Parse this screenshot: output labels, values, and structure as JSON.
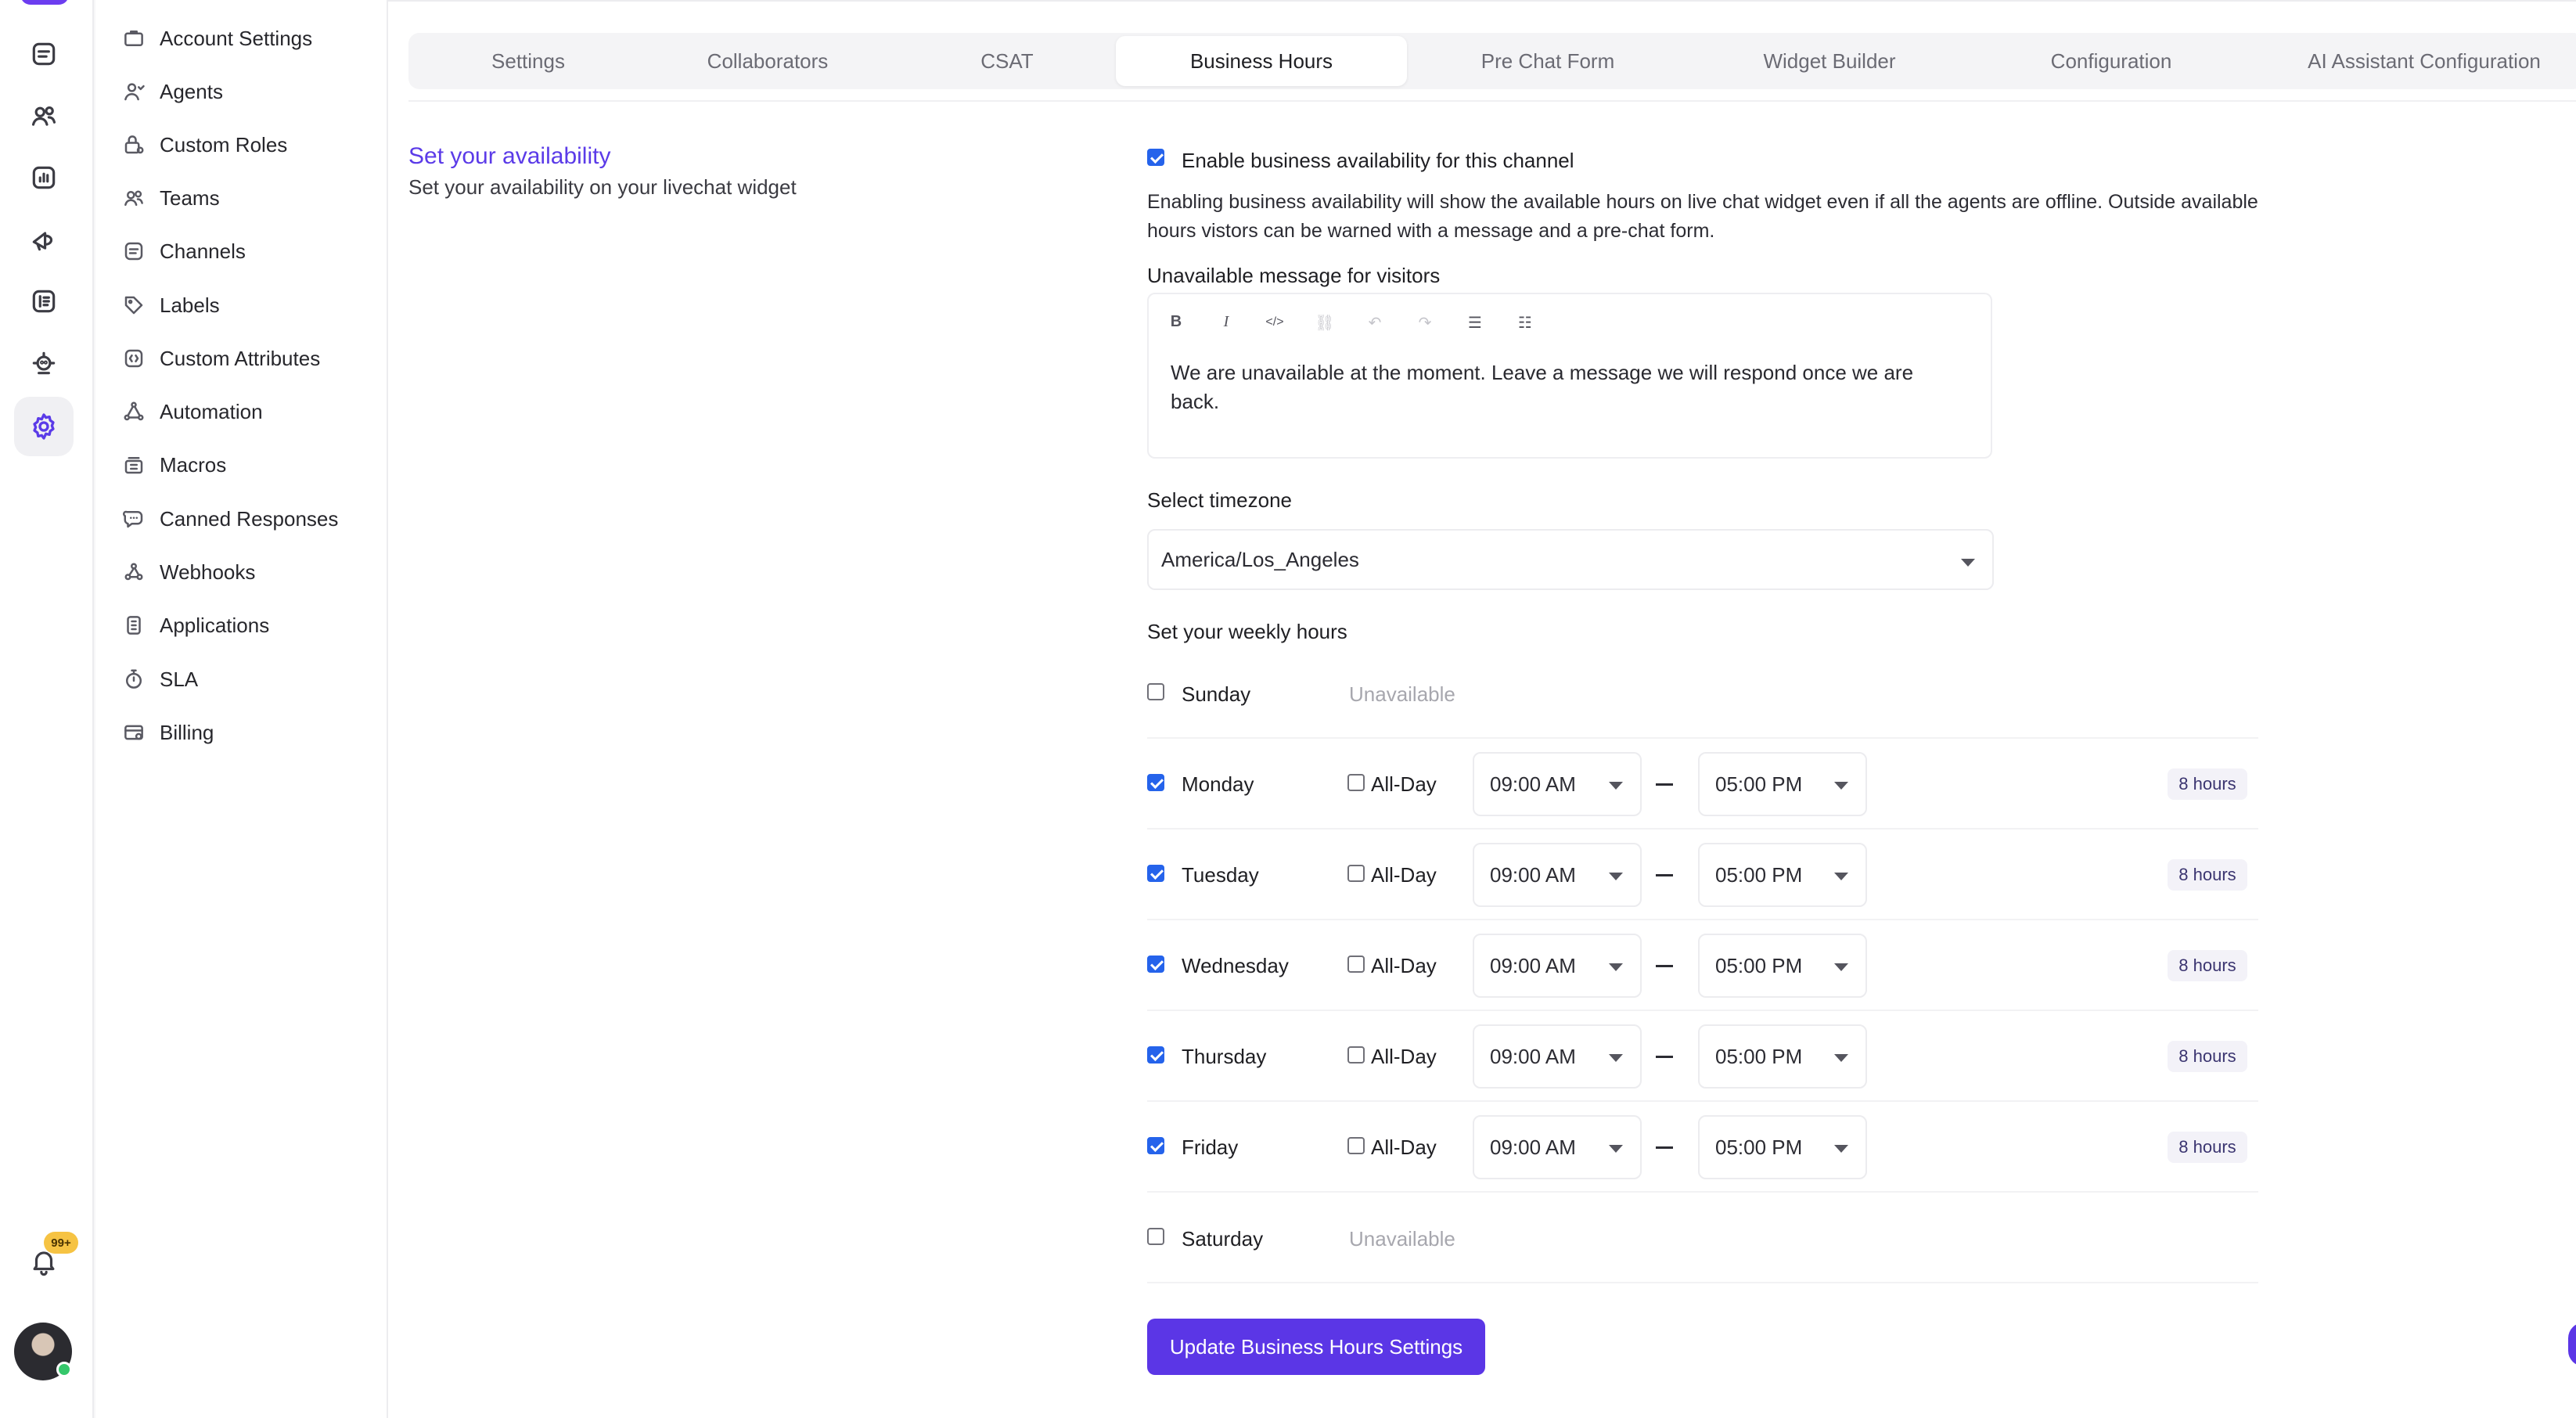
{
  "sidebar": {
    "items": [
      {
        "label": "Account Settings",
        "icon": "briefcase-icon"
      },
      {
        "label": "Agents",
        "icon": "user-icon"
      },
      {
        "label": "Custom Roles",
        "icon": "lock-icon"
      },
      {
        "label": "Teams",
        "icon": "users-icon"
      },
      {
        "label": "Channels",
        "icon": "inbox-icon"
      },
      {
        "label": "Labels",
        "icon": "tag-icon"
      },
      {
        "label": "Custom Attributes",
        "icon": "code-icon"
      },
      {
        "label": "Automation",
        "icon": "automation-icon"
      },
      {
        "label": "Macros",
        "icon": "macros-icon"
      },
      {
        "label": "Canned Responses",
        "icon": "chat-icon"
      },
      {
        "label": "Webhooks",
        "icon": "webhook-icon"
      },
      {
        "label": "Applications",
        "icon": "app-icon"
      },
      {
        "label": "SLA",
        "icon": "timer-icon"
      },
      {
        "label": "Billing",
        "icon": "billing-icon"
      }
    ]
  },
  "rail": {
    "notification_count": "99+"
  },
  "tabs": [
    {
      "label": "Settings",
      "active": false
    },
    {
      "label": "Collaborators",
      "active": false
    },
    {
      "label": "CSAT",
      "active": false
    },
    {
      "label": "Business Hours",
      "active": true
    },
    {
      "label": "Pre Chat Form",
      "active": false
    },
    {
      "label": "Widget Builder",
      "active": false
    },
    {
      "label": "Configuration",
      "active": false
    },
    {
      "label": "AI Assistant Configuration",
      "active": false
    }
  ],
  "section": {
    "title": "Set your availability",
    "subtitle": "Set your availability on your livechat widget"
  },
  "availability": {
    "enable_label": "Enable business availability for this channel",
    "enabled": true,
    "description": "Enabling business availability will show the available hours on live chat widget even if all the agents are offline. Outside available hours vistors can be warned with a message and a pre-chat form.",
    "message_label": "Unavailable message for visitors",
    "message_text": "We are unavailable at the moment. Leave a message we will respond once we are back.",
    "timezone_label": "Select timezone",
    "timezone_value": "America/Los_Angeles",
    "weekly_label": "Set your weekly hours"
  },
  "editor_toolbar": {
    "bold": "B",
    "italic": "I",
    "code": "</>",
    "link": "⛓",
    "undo": "↶",
    "redo": "↷",
    "bullet_list": "☰",
    "ordered_list": "☷"
  },
  "days": [
    {
      "name": "Sunday",
      "enabled": false,
      "status": "Unavailable"
    },
    {
      "name": "Monday",
      "enabled": true,
      "all_day_label": "All-Day",
      "start": "09:00 AM",
      "end": "05:00 PM",
      "hours": "8 hours"
    },
    {
      "name": "Tuesday",
      "enabled": true,
      "all_day_label": "All-Day",
      "start": "09:00 AM",
      "end": "05:00 PM",
      "hours": "8 hours"
    },
    {
      "name": "Wednesday",
      "enabled": true,
      "all_day_label": "All-Day",
      "start": "09:00 AM",
      "end": "05:00 PM",
      "hours": "8 hours"
    },
    {
      "name": "Thursday",
      "enabled": true,
      "all_day_label": "All-Day",
      "start": "09:00 AM",
      "end": "05:00 PM",
      "hours": "8 hours"
    },
    {
      "name": "Friday",
      "enabled": true,
      "all_day_label": "All-Day",
      "start": "09:00 AM",
      "end": "05:00 PM",
      "hours": "8 hours"
    },
    {
      "name": "Saturday",
      "enabled": false,
      "status": "Unavailable"
    }
  ],
  "actions": {
    "update_label": "Update Business Hours Settings"
  },
  "colors": {
    "accent": "#5b36e6",
    "checkbox": "#2563eb",
    "badge": "#f6c343",
    "online": "#35c76b"
  }
}
